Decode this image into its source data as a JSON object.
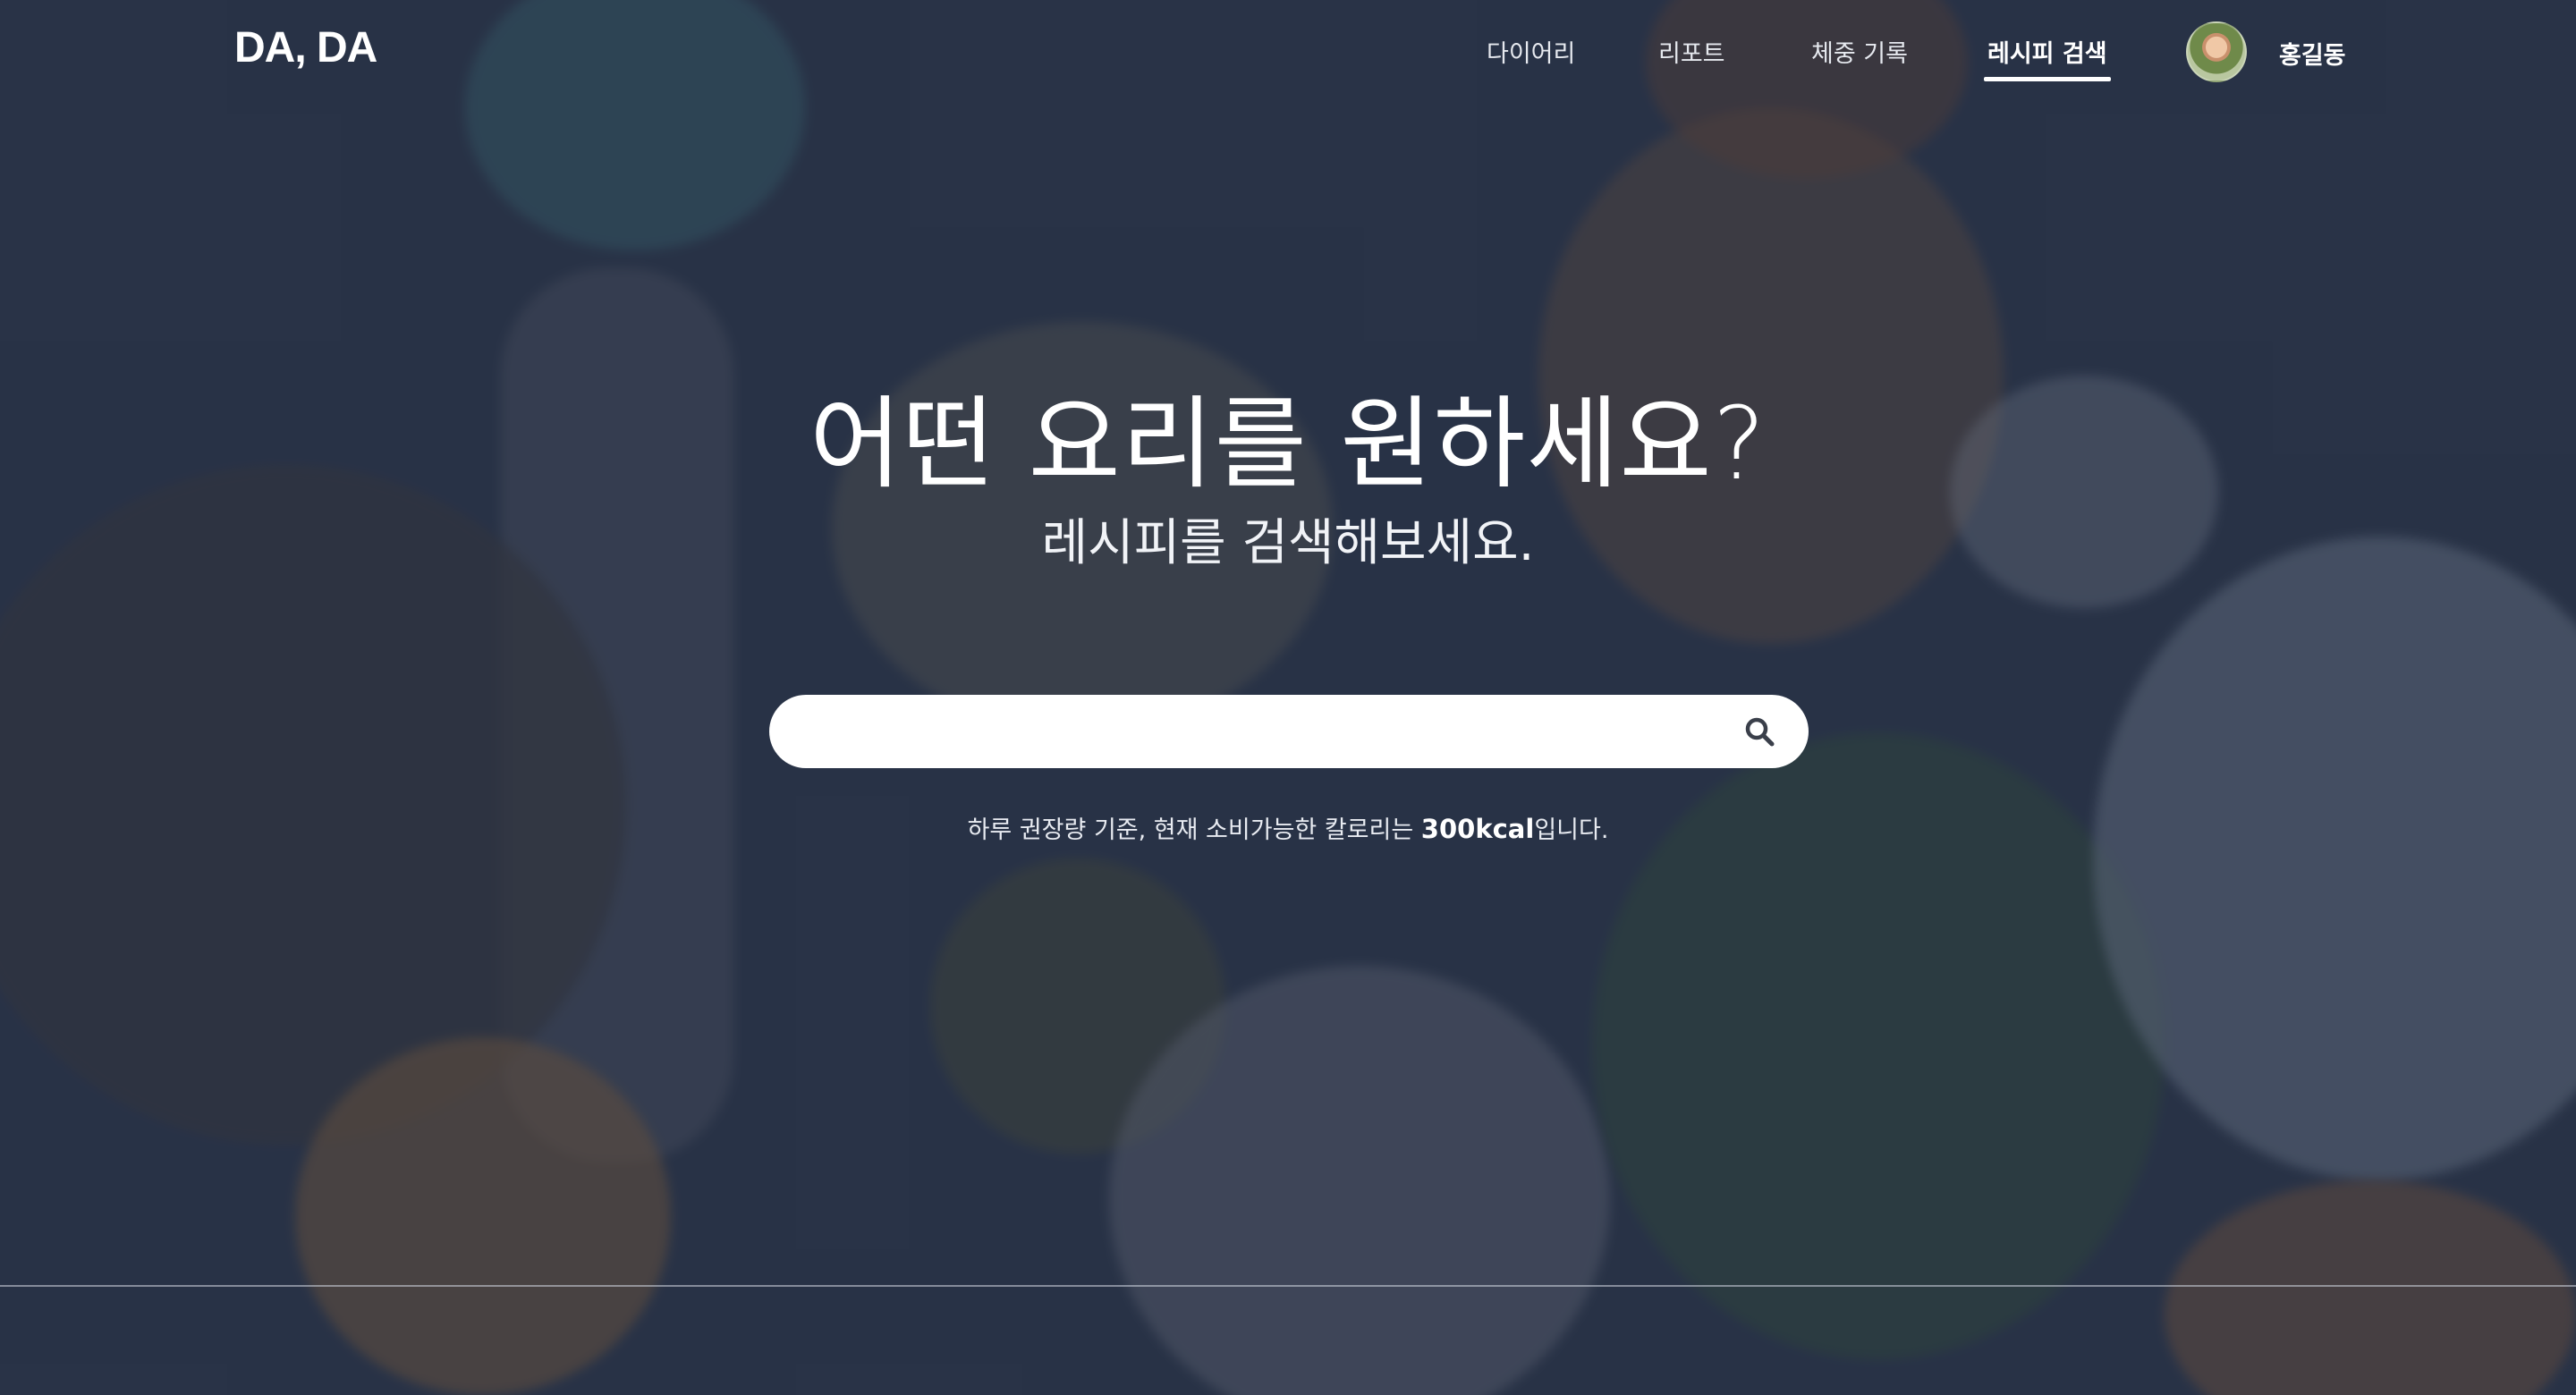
{
  "brand": {
    "logo": "DA, DA"
  },
  "nav": {
    "items": [
      {
        "label": "다이어리",
        "active": false
      },
      {
        "label": "리포트",
        "active": false
      },
      {
        "label": "체중 기록",
        "active": false
      },
      {
        "label": "레시피 검색",
        "active": true
      }
    ]
  },
  "user": {
    "name": "홍길동"
  },
  "hero": {
    "headline": "어떤 요리를 원하세요?",
    "subline": "레시피를 검색해보세요."
  },
  "search": {
    "value": "",
    "placeholder": "",
    "icon": "search-icon"
  },
  "calorie": {
    "prefix": "하루 권장량 기준, 현재 소비가능한 칼로리는 ",
    "value": "300kcal",
    "suffix": "입니다."
  },
  "colors": {
    "overlay": "#2c374b",
    "text": "#ffffff"
  }
}
